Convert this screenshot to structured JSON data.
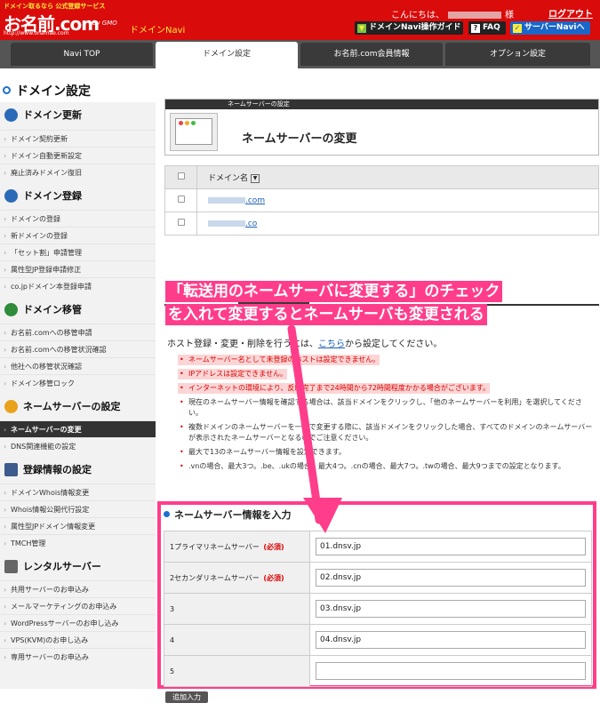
{
  "header": {
    "logo_tagline": "ドメイン取るなら 公式登録サービス",
    "logo_main": "お名前.com",
    "logo_url": "http://www.onamae.com",
    "logo_gmo": "by GMO",
    "navi_title": "ドメインNavi",
    "greeting": "こんにちは、",
    "greeting_suffix": "様",
    "logout": "ログアウト",
    "guide_button": "ドメインNavi操作ガイド",
    "faq_button": "FAQ",
    "server_navi_button": "サーバーNaviへ"
  },
  "tabs": [
    {
      "label": "Navi TOP"
    },
    {
      "label": "ドメイン設定"
    },
    {
      "label": "お名前.com会員情報"
    },
    {
      "label": "オプション設定"
    }
  ],
  "sidebar": {
    "page_title": "ドメイン設定",
    "sections": [
      {
        "title": "ドメイン更新",
        "items": [
          "ドメイン契約更新",
          "ドメイン自動更新設定",
          "廃止済みドメイン復旧"
        ]
      },
      {
        "title": "ドメイン登録",
        "items": [
          "ドメインの登録",
          "新ドメインの登録",
          "「セット割」申請管理",
          "属性型JP登録申請修正",
          "co.jpドメイン本登録申請"
        ]
      },
      {
        "title": "ドメイン移管",
        "items": [
          "お名前.comへの移管申請",
          "お名前.comへの移管状況確認",
          "他社への移管状況確認",
          "ドメイン移管ロック"
        ]
      },
      {
        "title": "ネームサーバーの設定",
        "items": [
          "ネームサーバーの変更",
          "DNS関連機能の設定"
        ]
      },
      {
        "title": "登録情報の設定",
        "items": [
          "ドメインWhois情報変更",
          "Whois情報公開代行設定",
          "属性型JPドメイン情報変更",
          "TMCH管理"
        ]
      },
      {
        "title": "レンタルサーバー",
        "items": [
          "共用サーバーのお申込み",
          "メールマーケティングのお申込み",
          "WordPressサーバーのお申し込み",
          "VPS(KVM)のお申し込み",
          "専用サーバーのお申込み"
        ]
      }
    ]
  },
  "main": {
    "section_label": "ネームサーバーの設定",
    "title": "ネームサーバーの変更",
    "domain_column": "ドメイン名",
    "sort_icon": "▼",
    "domains": [
      ".com",
      ".co"
    ],
    "annotation_line1": "「転送用のネームサーバに変更する」のチェック",
    "annotation_line2": "を入れて変更するとネームサーバも変更される",
    "host_text_before": "ホスト登録・変更・削除を行うには、",
    "host_link": "こちら",
    "host_text_after": "から設定してください。",
    "notes": [
      "ネームサーバー名として未登録のホストは設定できません。",
      "IPアドレスは設定できません。",
      "インターネットの環境により、反映完了まで24時間から72時間程度かかる場合がございます。",
      "現在のネームサーバー情報を確認する場合は、該当ドメインをクリックし、「他のネームサーバーを利用」を選択してください。",
      "複数ドメインのネームサーバーを一括で変更する際に、該当ドメインをクリックした場合、すべてのドメインのネームサーバーが表示されたネームサーバーとなるのでご注意ください。",
      "最大で13のネームサーバー情報を設定できます。",
      ".vnの場合、最大3つ。.be、.ukの場合、最大4つ。.cnの場合、最大7つ。.twの場合、最大9つまでの設定となります。"
    ],
    "form_title": "ネームサーバー情報を入力",
    "required_label": "(必須)",
    "rows": [
      {
        "label": "1プライマリネームサーバー",
        "required": true,
        "value": "01.dnsv.jp"
      },
      {
        "label": "2セカンダリネームサーバー",
        "required": true,
        "value": "02.dnsv.jp"
      },
      {
        "label": "3",
        "required": false,
        "value": "03.dnsv.jp"
      },
      {
        "label": "4",
        "required": false,
        "value": "04.dnsv.jp"
      },
      {
        "label": "5",
        "required": false,
        "value": ""
      }
    ],
    "add_button": "追加入力"
  },
  "colors": {
    "header_red": "#d90b0b",
    "annotation_pink": "#ff3d8a",
    "link_blue": "#1a5fb4"
  }
}
